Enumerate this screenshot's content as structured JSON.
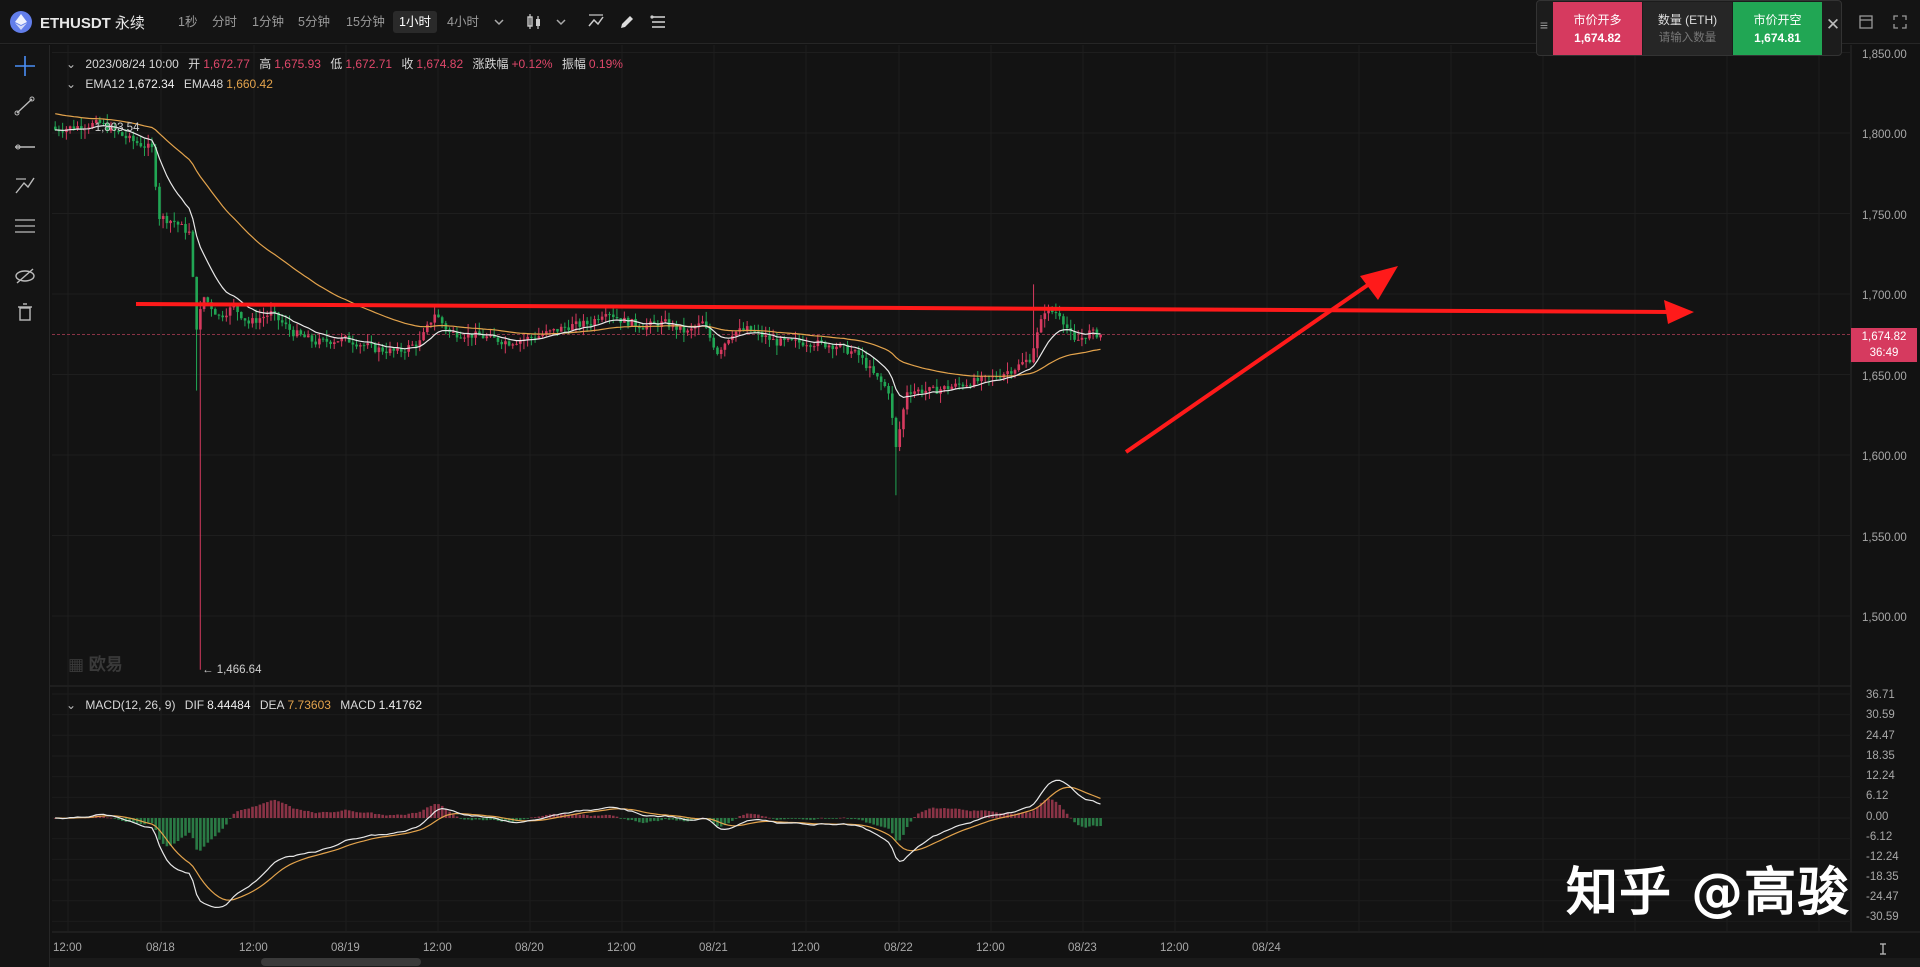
{
  "header": {
    "symbol": "ETHUSDT",
    "contract": "永续",
    "timeframes": [
      "1秒",
      "分时",
      "1分钟",
      "5分钟",
      "15分钟",
      "1小时",
      "4小时"
    ],
    "active_timeframe": "1小时"
  },
  "trade_panel": {
    "long_label": "市价开多",
    "long_price": "1,674.82",
    "qty_label": "数量 (ETH)",
    "qty_placeholder": "请输入数量",
    "short_label": "市价开空",
    "short_price": "1,674.81"
  },
  "ohlc_legend": {
    "datetime": "2023/08/24 10:00",
    "open_label": "开",
    "open": "1,672.77",
    "high_label": "高",
    "high": "1,675.93",
    "low_label": "低",
    "low": "1,672.71",
    "close_label": "收",
    "close": "1,674.82",
    "change_label": "涨跌幅",
    "change": "+0.12%",
    "amplitude_label": "振幅",
    "amplitude": "0.19%"
  },
  "ema_legend": {
    "ema12_label": "EMA12",
    "ema12": "1,672.34",
    "ema48_label": "EMA48",
    "ema48": "1,660.42"
  },
  "macd_legend": {
    "title": "MACD(12, 26, 9)",
    "dif_label": "DIF",
    "dif": "8.44484",
    "dea_label": "DEA",
    "dea": "7.73603",
    "macd_label": "MACD",
    "macd": "1.41762"
  },
  "price_tag": {
    "price": "1,674.82",
    "countdown": "36:49"
  },
  "annotations": {
    "high_marker": "1,803.54",
    "low_marker": "1,466.64"
  },
  "price_axis": [
    "1,850.00",
    "1,800.00",
    "1,750.00",
    "1,700.00",
    "1,650.00",
    "1,600.00",
    "1,550.00",
    "1,500.00"
  ],
  "macd_axis": [
    "36.71",
    "30.59",
    "24.47",
    "18.35",
    "12.24",
    "6.12",
    "0.00",
    "-6.12",
    "-12.24",
    "-18.35",
    "-24.47",
    "-30.59"
  ],
  "time_axis": [
    "12:00",
    "08/18",
    "12:00",
    "08/19",
    "12:00",
    "08/20",
    "12:00",
    "08/21",
    "12:00",
    "08/22",
    "12:00",
    "08/23",
    "12:00",
    "08/24"
  ],
  "watermark": "知乎 @高骏",
  "exchange_watermark": "欧易",
  "colors": {
    "up": "#d63a5f",
    "down": "#21a654",
    "ema12": "#e8e8e8",
    "ema48": "#e3a34c",
    "drawing": "#ff1a1a"
  },
  "chart_data": {
    "type": "candlestick",
    "interval": "1h",
    "price_ylim": [
      1450,
      1850
    ],
    "macd_ylim": [
      -36.71,
      36.71
    ],
    "key_prices": {
      "session_high": 1803.54,
      "session_low": 1466.64,
      "last": 1674.82
    },
    "drawn_objects": [
      {
        "type": "horizontal-arrow",
        "price_start": 1695,
        "price_end": 1691
      },
      {
        "type": "trend-arrow",
        "price_start": 1604,
        "price_end": 1718
      }
    ],
    "macd": {
      "dif": 8.44484,
      "dea": 7.73603,
      "hist": 1.41762
    }
  }
}
